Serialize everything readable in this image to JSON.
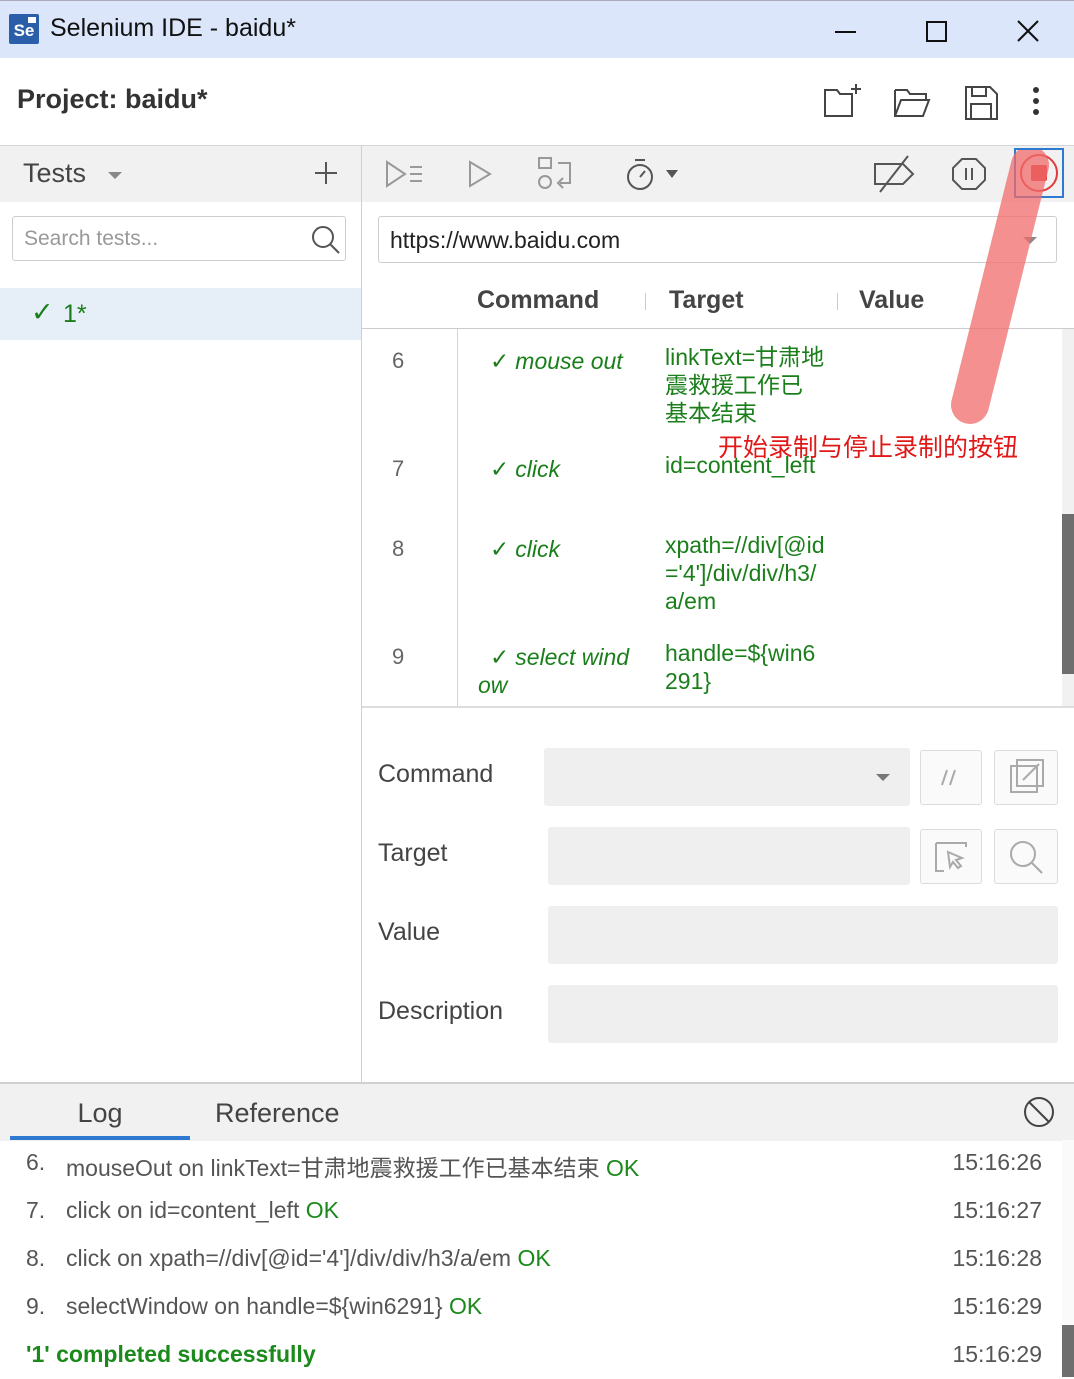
{
  "window": {
    "logo_text": "Se",
    "title": "Selenium IDE - baidu*",
    "controls": [
      "minimize-icon",
      "maximize-icon",
      "close-icon"
    ]
  },
  "project": {
    "label": "Project:  baidu*",
    "actions": [
      "new-project-icon",
      "open-project-icon",
      "save-project-icon",
      "more-options-icon"
    ]
  },
  "tests_panel": {
    "title": "Tests",
    "add_icon": "plus-icon",
    "search_placeholder": "Search tests...",
    "tests": [
      {
        "check": "✓",
        "name": "1*"
      }
    ]
  },
  "toolbar": {
    "icons": [
      "run-all-tests-icon",
      "run-current-test-icon",
      "step-over-icon",
      "test-speed-icon",
      "disable-breakpoints-icon",
      "pause-on-exceptions-icon",
      "record-stop-icon"
    ]
  },
  "url": {
    "value": "https://www.baidu.com"
  },
  "table": {
    "headers": {
      "command": "Command",
      "target": "Target",
      "value": "Value"
    },
    "rows": [
      {
        "num": "6",
        "check": "✓",
        "command": "mouse out",
        "target": "linkText=甘肃地震救援工作已基本结束"
      },
      {
        "num": "7",
        "check": "✓",
        "command": "click",
        "target": "id=content_left"
      },
      {
        "num": "8",
        "check": "✓",
        "command": "click",
        "target": "xpath=//div[@id='4']/div/div/h3/a/em"
      },
      {
        "num": "9",
        "check": "✓",
        "command": "select window",
        "target": "handle=${win6291}"
      }
    ]
  },
  "annotation": {
    "text": "开始录制与停止录制的按钮",
    "color": "#e01818"
  },
  "editor": {
    "command_label": "Command",
    "target_label": "Target",
    "value_label": "Value",
    "description_label": "Description"
  },
  "log": {
    "tabs": {
      "log": "Log",
      "reference": "Reference"
    },
    "clear_icon": "clear-log-icon",
    "entries": [
      {
        "idx": "6.",
        "msg": "mouseOut on linkText=甘肃地震救援工作已基本结束",
        "status": "OK",
        "time": "15:16:26"
      },
      {
        "idx": "7.",
        "msg": "click on id=content_left",
        "status": "OK",
        "time": "15:16:27"
      },
      {
        "idx": "8.",
        "msg": "click on xpath=//div[@id='4']/div/div/h3/a/em",
        "status": "OK",
        "time": "15:16:28"
      },
      {
        "idx": "9.",
        "msg": "selectWindow on handle=${win6291}",
        "status": "OK",
        "time": "15:16:29"
      }
    ],
    "summary": {
      "msg": "'1' completed successfully",
      "time": "15:16:29"
    }
  },
  "colors": {
    "title_bar": "#dbe6fa",
    "ok_green": "#1a8a1a",
    "accent_blue": "#2f7ad1",
    "record_red": "#e03c3c"
  }
}
